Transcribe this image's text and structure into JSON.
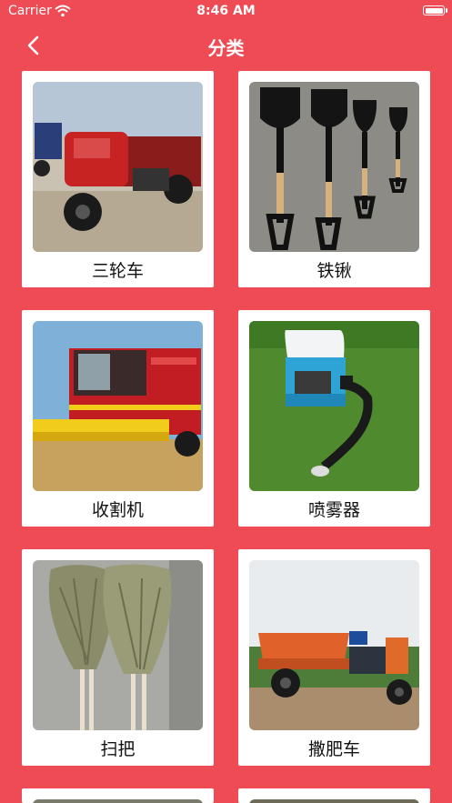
{
  "status_bar": {
    "carrier": "Carrier",
    "time": "8:46 AM"
  },
  "nav": {
    "title": "分类",
    "back_icon": "chevron-left-icon"
  },
  "categories": [
    {
      "label": "三轮车"
    },
    {
      "label": "铁锹"
    },
    {
      "label": "收割机"
    },
    {
      "label": "喷雾器"
    },
    {
      "label": "扫把"
    },
    {
      "label": "撒肥车"
    }
  ],
  "colors": {
    "background": "#EE4B55",
    "card": "#FFFFFF"
  }
}
